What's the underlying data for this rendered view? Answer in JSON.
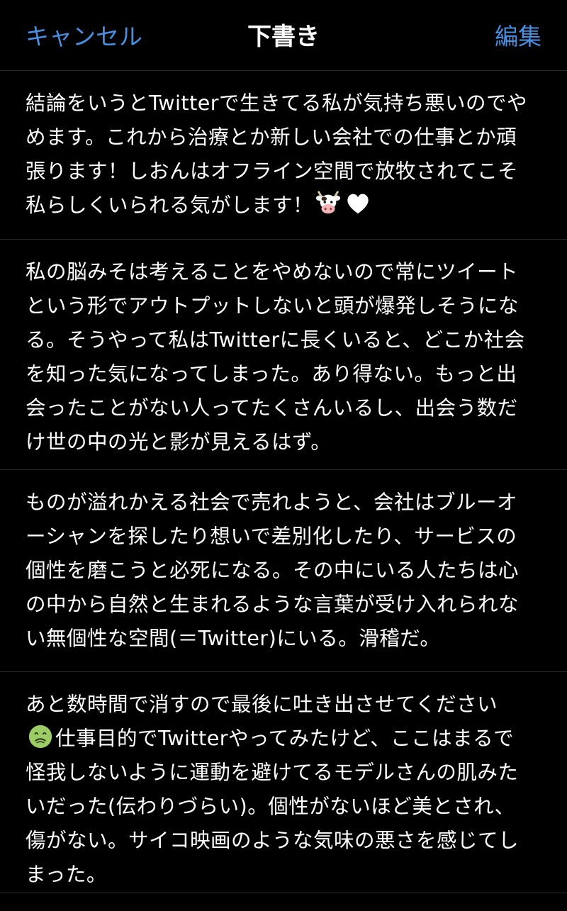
{
  "nav": {
    "cancel_label": "キャンセル",
    "title": "下書き",
    "edit_label": "編集"
  },
  "drafts": [
    {
      "text_before_emoji": "結論をいうとTwitterで生きてる私が気持ち悪いのでや\nめます。これから治療とか新しい会社での仕事とか頑\n張ります！しおんはオフライン空間で放牧されてこそ\n私らしくいられる気がします！",
      "emojis": [
        "cow-face",
        "white-heart"
      ],
      "text_after_emoji": ""
    },
    {
      "text": "私の脳みそは考えることをやめないので常にツイート\nという形でアウトプットしないと頭が爆発しそうにな\nる。そうやって私はTwitterに長くいると、どこか社会\nを知った気になってしまった。あり得ない。もっと出\n会ったことがない人ってたくさんいるし、出会う数だ\nけ世の中の光と影が見えるはず。"
    },
    {
      "text": "ものが溢れかえる社会で売れようと、会社はブルーオ\nーシャンを探したり想いで差別化したり、サービスの\n個性を磨こうと必死になる。その中にいる人たちは心\nの中から自然と生まれるような言葉が受け入れられな\nい無個性な空間(＝Twitter)にいる。滑稽だ。"
    },
    {
      "text_line1": "あと数時間で消すので最後に吐き出させてください",
      "emoji": "nauseated-face",
      "text_rest": "仕事目的でTwitterやってみたけど、ここはまるで\n怪我しないように運動を避けてるモデルさんの肌みた\nいだった(伝わりづらい)。個性がないほど美とされ、\n傷がない。サイコ映画のような気味の悪さを感じてし\nまった。"
    }
  ],
  "colors": {
    "background": "#000000",
    "accent": "#4a90e2",
    "text": "#ffffff",
    "separator": "#2a2a2c"
  }
}
